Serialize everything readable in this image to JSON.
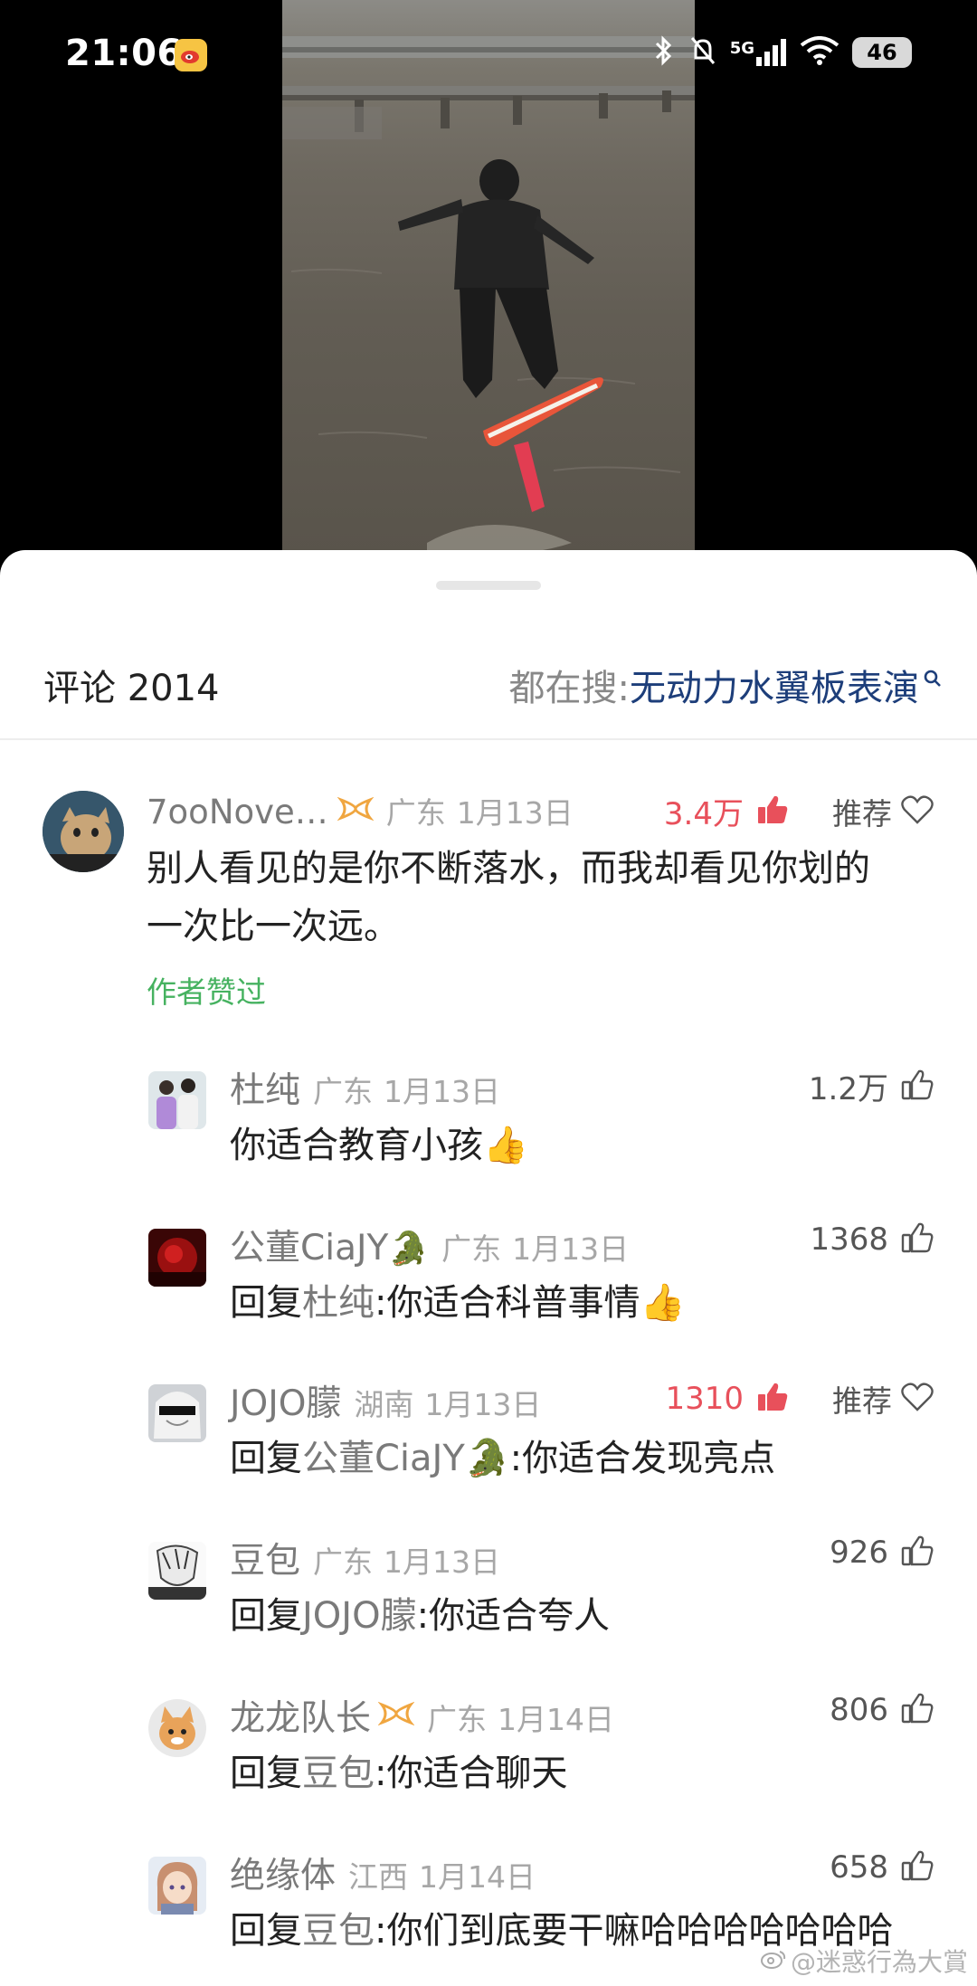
{
  "status_bar": {
    "time": "21:06",
    "network": "5G",
    "battery": "46"
  },
  "video": {
    "board_color": "#e8553a",
    "water_color": "#6d685f"
  },
  "comments_panel": {
    "title": "评论 2014",
    "search_label": "都在搜: ",
    "search_term": "无动力水翼板表演"
  },
  "comments": [
    {
      "username": "7ooNove…",
      "region": "广东",
      "date": "1月13日",
      "likes": "3.4万",
      "liked": true,
      "recommend": "推荐",
      "text": "别人看见的是你不断落水，而我却看见你划的一次比一次远。",
      "text_line1": "别人看见的是你不断落水，而我却看见你划的",
      "text_line2": "一次比一次远。",
      "badge": "作者赞过"
    }
  ],
  "replies": [
    {
      "username": "杜纯",
      "region": "广东",
      "date": "1月13日",
      "likes": "1.2万",
      "text": "你适合教育小孩",
      "emoji": "👍"
    },
    {
      "username": "公董CiaJY",
      "username_emoji": "🐊",
      "region": "广东",
      "date": "1月13日",
      "likes": "1368",
      "reply_prefix": "回复",
      "reply_to": "杜纯",
      "text": ":你适合科普事情",
      "emoji": "👍"
    },
    {
      "username": "JOJO朦",
      "region": "湖南",
      "date": "1月13日",
      "likes": "1310",
      "liked": true,
      "recommend": "推荐",
      "reply_prefix": "回复",
      "reply_to": "公董CiaJY",
      "reply_to_emoji": "🐊",
      "text": ":你适合发现亮点"
    },
    {
      "username": "豆包",
      "region": "广东",
      "date": "1月13日",
      "likes": "926",
      "reply_prefix": "回复",
      "reply_to": "JOJO朦",
      "text": ":你适合夸人"
    },
    {
      "username": "龙龙队长",
      "region": "广东",
      "date": "1月14日",
      "likes": "806",
      "reply_prefix": "回复",
      "reply_to": "豆包",
      "text": ":你适合聊天"
    },
    {
      "username": "绝缘体",
      "region": "江西",
      "date": "1月14日",
      "likes": "658",
      "reply_prefix": "回复",
      "reply_to": "豆包",
      "text": ":你们到底要干嘛哈哈哈哈哈哈哈"
    }
  ],
  "watermark": "@迷惑行為大賞",
  "colors": {
    "hot_like": "#e8505b",
    "author_liked": "#46b260",
    "search_term": "#1d3e7a",
    "vip_badge": "#f0a640"
  }
}
